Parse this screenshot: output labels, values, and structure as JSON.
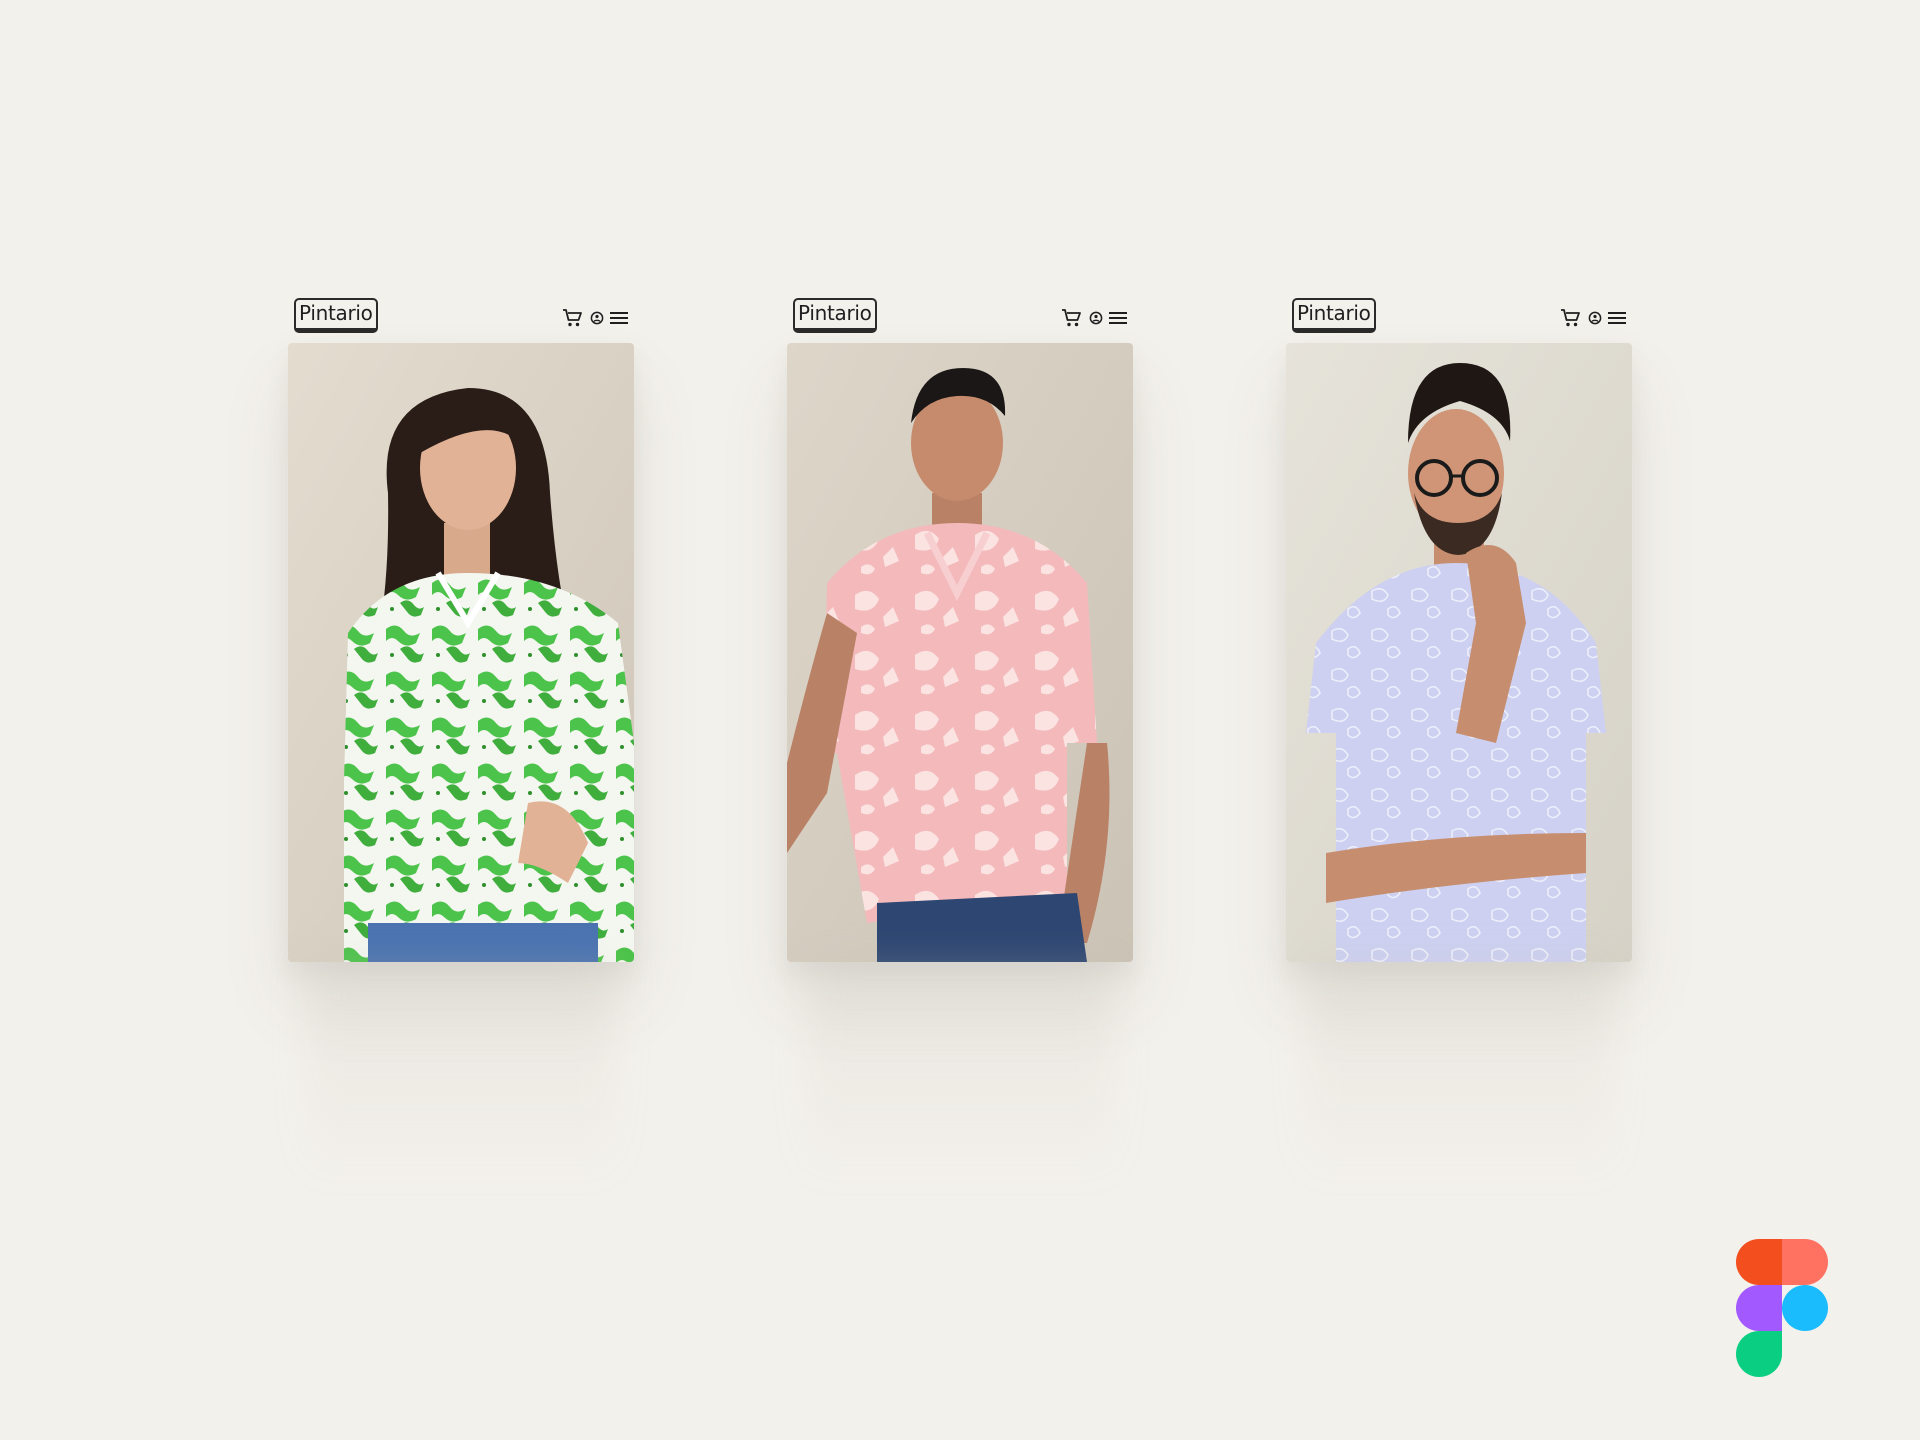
{
  "page": {
    "background": "#f3f1ec"
  },
  "screens": [
    {
      "brand": "Pintario",
      "icons": [
        "cart-icon",
        "user-icon",
        "menu-icon"
      ],
      "photo": {
        "subject": "woman-green-print-shirt",
        "shirt_color": "#4cc34a",
        "background_color": "#d9d2c6"
      }
    },
    {
      "brand": "Pintario",
      "icons": [
        "cart-icon",
        "user-icon",
        "menu-icon"
      ],
      "photo": {
        "subject": "man-pink-print-shirt",
        "shirt_color": "#f4b9bb",
        "background_color": "#d6cfc2"
      }
    },
    {
      "brand": "Pintario",
      "icons": [
        "cart-icon",
        "user-icon",
        "menu-icon"
      ],
      "photo": {
        "subject": "man-lavender-print-shirt",
        "shirt_color": "#c8cbef",
        "background_color": "#e1ded5"
      }
    }
  ],
  "corner_logo": {
    "name": "figma-logo",
    "colors": [
      "#f24e1e",
      "#ff7262",
      "#a259ff",
      "#1abcfe",
      "#0acf83"
    ]
  }
}
